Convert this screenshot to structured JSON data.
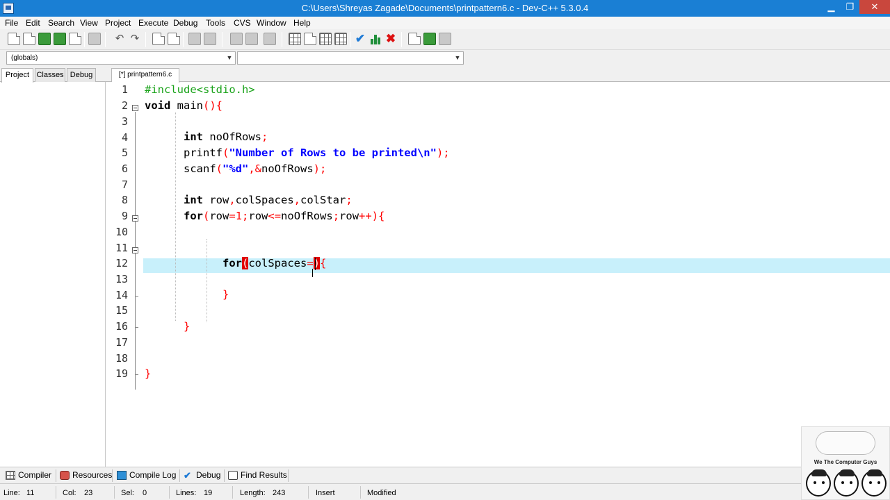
{
  "window": {
    "title": "C:\\Users\\Shreyas Zagade\\Documents\\printpattern6.c - Dev-C++ 5.3.0.4",
    "minimize": "▁",
    "maximize": "❐",
    "close": "✕"
  },
  "menu": [
    "File",
    "Edit",
    "Search",
    "View",
    "Project",
    "Execute",
    "Debug",
    "Tools",
    "CVS",
    "Window",
    "Help"
  ],
  "scope_combo": {
    "value": "(globals)"
  },
  "member_combo": {
    "value": ""
  },
  "left_panel": {
    "tabs": [
      "Project",
      "Classes",
      "Debug"
    ],
    "active_tab": "Project"
  },
  "editor": {
    "tab_label": "[*] printpattern6.c",
    "line_numbers": [
      "1",
      "2",
      "3",
      "4",
      "5",
      "6",
      "7",
      "8",
      "9",
      "10",
      "11",
      "12",
      "13",
      "14",
      "15",
      "16",
      "17",
      "18",
      "19"
    ],
    "current_line": 11
  },
  "bottom_tabs": [
    {
      "label": "Compiler",
      "icon": "compiler-icon"
    },
    {
      "label": "Resources",
      "icon": "resources-icon"
    },
    {
      "label": "Compile Log",
      "icon": "compile-log-icon"
    },
    {
      "label": "Debug",
      "icon": "debug-icon"
    },
    {
      "label": "Find Results",
      "icon": "find-results-icon"
    }
  ],
  "status": {
    "line_label": "Line:",
    "line_value": "11",
    "col_label": "Col:",
    "col_value": "23",
    "sel_label": "Sel:",
    "sel_value": "0",
    "lines_label": "Lines:",
    "lines_value": "19",
    "length_label": "Length:",
    "length_value": "243",
    "mode": "Insert",
    "state": "Modified"
  },
  "logo": {
    "tagline": "We The Computer Guys"
  },
  "colors": {
    "titlebar": "#1a7fd4",
    "current_line": "#c8f0fb",
    "brace_highlight": "#e00000",
    "string": "#0000ff",
    "preprocessor": "#1aa31a",
    "symbol": "#ff0000"
  }
}
